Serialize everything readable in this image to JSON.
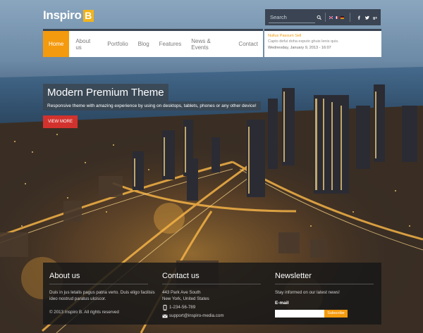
{
  "logo": {
    "text": "Inspiro",
    "badge": "B"
  },
  "topbar": {
    "search_placeholder": "Search",
    "icons": [
      "search-icon",
      "flag-uk-icon",
      "flag-fr-icon",
      "flag-de-icon",
      "facebook-icon",
      "twitter-icon",
      "google-plus-icon"
    ]
  },
  "nav": {
    "items": [
      {
        "label": "Home",
        "active": true
      },
      {
        "label": "About us"
      },
      {
        "label": "Portfolio"
      },
      {
        "label": "Blog"
      },
      {
        "label": "Features"
      },
      {
        "label": "News & Events"
      },
      {
        "label": "Contact"
      }
    ]
  },
  "ticker": {
    "title": "Nullus Passum Sell",
    "text": "Capto defui doha exputo ghuis lenis quis.",
    "date": "Wednesday, January 9, 2013 - 16:07"
  },
  "hero": {
    "title": "Modern Premium Theme",
    "subtitle": "Responsive theme with amazing experience by using on desktops, tablets, phones or any other device!",
    "button": "VIEW MORE"
  },
  "footer": {
    "about": {
      "heading": "About us",
      "text": "Duis in jus letalis pagus patria verto. Duis eligo facilisis ideo nostrud paratus ulciscor.",
      "copyright": "© 2013 Inspiro B. All rights reserved"
    },
    "contact": {
      "heading": "Contact us",
      "address1": "443 Park Ave South",
      "address2": "New York, United States",
      "phone": "1-234-56-789",
      "email": "support@inspiro-media.com"
    },
    "newsletter": {
      "heading": "Newsletter",
      "text": "Stay informed on our latest news!",
      "email_label": "E-mail",
      "button": "Subscribe"
    }
  },
  "colors": {
    "accent": "#f49a0e",
    "button_red": "#d2322d",
    "bar_dark": "#3a4452"
  }
}
